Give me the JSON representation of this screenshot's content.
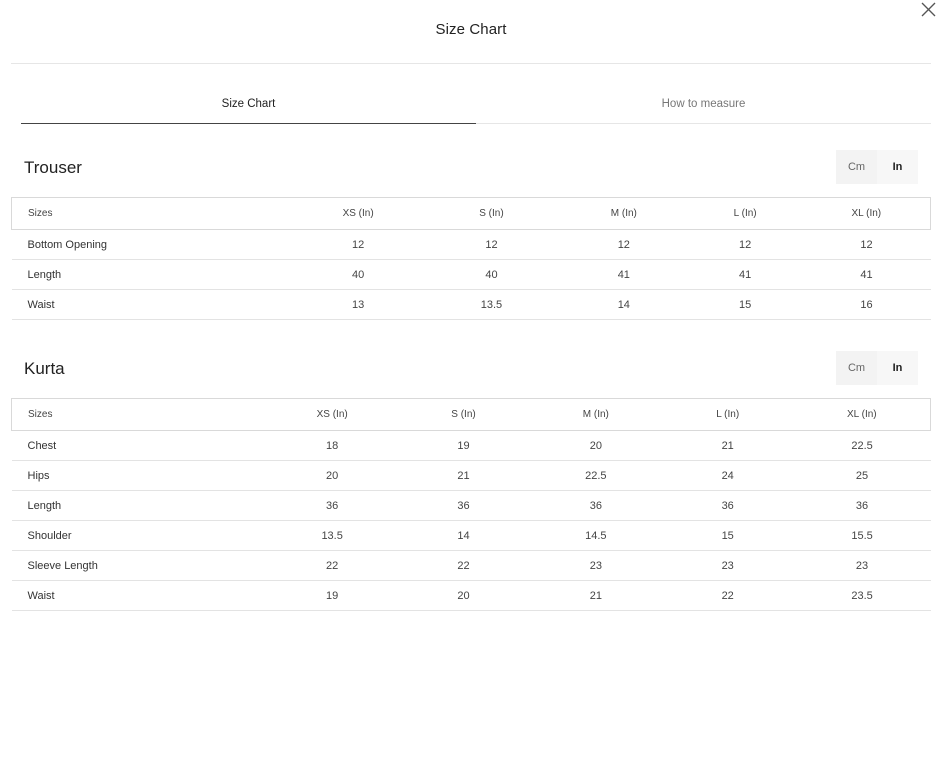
{
  "modal": {
    "title": "Size Chart"
  },
  "tabs": [
    {
      "label": "Size Chart",
      "active": true
    },
    {
      "label": "How to measure",
      "active": false
    }
  ],
  "unit_toggle": {
    "cm_label": "Cm",
    "in_label": "In",
    "selected": "In"
  },
  "trouser": {
    "title": "Trouser",
    "headers": [
      "Sizes",
      "XS (In)",
      "S (In)",
      "M (In)",
      "L (In)",
      "XL (In)"
    ],
    "rows": [
      [
        "Bottom Opening",
        "12",
        "12",
        "12",
        "12",
        "12"
      ],
      [
        "Length",
        "40",
        "40",
        "41",
        "41",
        "41"
      ],
      [
        "Waist",
        "13",
        "13.5",
        "14",
        "15",
        "16"
      ]
    ]
  },
  "kurta": {
    "title": "Kurta",
    "headers": [
      "Sizes",
      "XS (In)",
      "S (In)",
      "M (In)",
      "L (In)",
      "XL (In)"
    ],
    "rows": [
      [
        "Chest",
        "18",
        "19",
        "20",
        "21",
        "22.5"
      ],
      [
        "Hips",
        "20",
        "21",
        "22.5",
        "24",
        "25"
      ],
      [
        "Length",
        "36",
        "36",
        "36",
        "36",
        "36"
      ],
      [
        "Shoulder",
        "13.5",
        "14",
        "14.5",
        "15",
        "15.5"
      ],
      [
        "Sleeve Length",
        "22",
        "22",
        "23",
        "23",
        "23"
      ],
      [
        "Waist",
        "19",
        "20",
        "21",
        "22",
        "23.5"
      ]
    ]
  }
}
